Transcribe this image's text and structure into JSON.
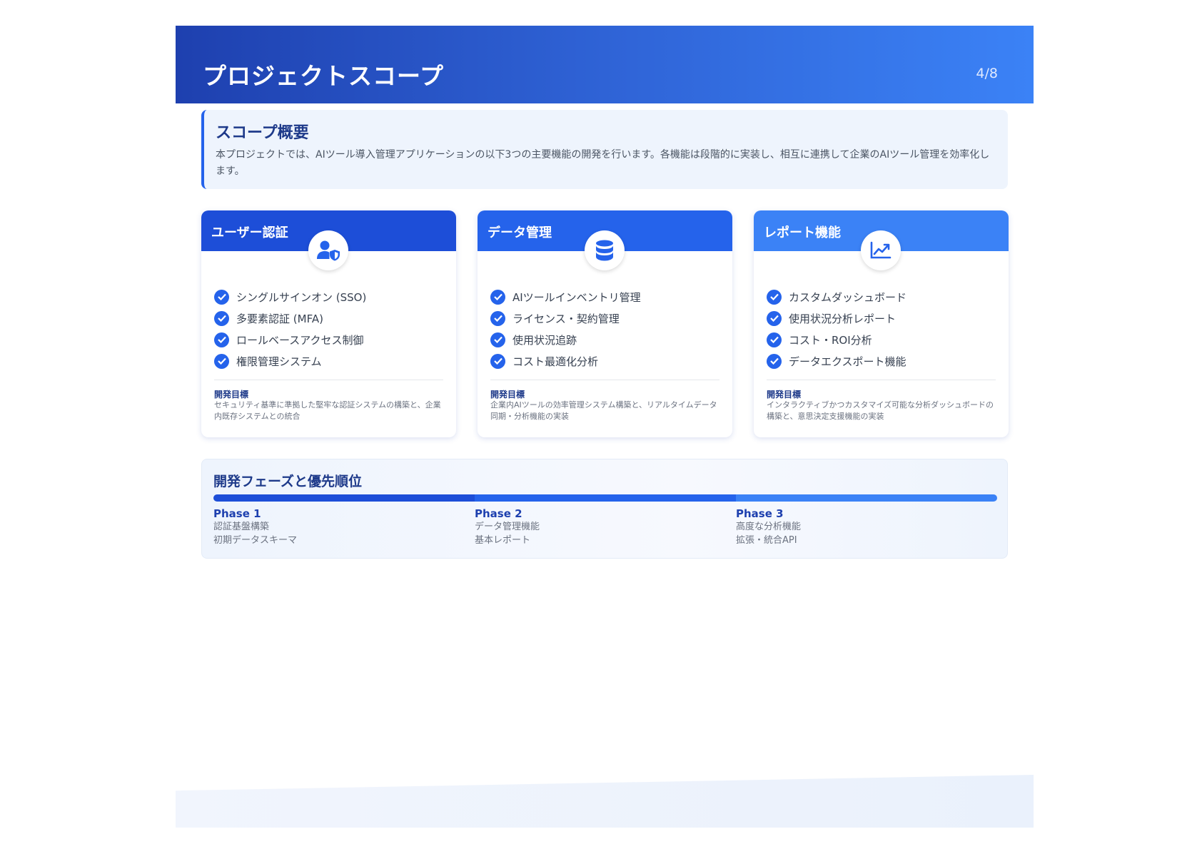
{
  "header": {
    "title": "プロジェクトスコープ",
    "page": "4/8"
  },
  "overview": {
    "title": "スコープ概要",
    "text": "本プロジェクトでは、AIツール導入管理アプリケーションの以下3つの主要機能の開発を行います。各機能は段階的に実装し、相互に連携して企業のAIツール管理を効率化します。"
  },
  "cards": [
    {
      "title": "ユーザー認証",
      "icon": "user-shield-icon",
      "header_color": "#1d4ed8",
      "items": [
        "シングルサインオン (SSO)",
        "多要素認証 (MFA)",
        "ロールベースアクセス制御",
        "権限管理システム"
      ],
      "goal_label": "開発目標",
      "goal_text": "セキュリティ基準に準拠した堅牢な認証システムの構築と、企業内既存システムとの統合"
    },
    {
      "title": "データ管理",
      "icon": "database-icon",
      "header_color": "#2563eb",
      "items": [
        "AIツールインベントリ管理",
        "ライセンス・契約管理",
        "使用状況追跡",
        "コスト最適化分析"
      ],
      "goal_label": "開発目標",
      "goal_text": "企業内AIツールの効率管理システム構築と、リアルタイムデータ同期・分析機能の実装"
    },
    {
      "title": "レポート機能",
      "icon": "chart-line-icon",
      "header_color": "#3b82f6",
      "items": [
        "カスタムダッシュボード",
        "使用状況分析レポート",
        "コスト・ROI分析",
        "データエクスポート機能"
      ],
      "goal_label": "開発目標",
      "goal_text": "インタラクティブかつカスタマイズ可能な分析ダッシュボードの構築と、意思決定支援機能の実装"
    }
  ],
  "phases": {
    "title": "開発フェーズと優先順位",
    "colors": [
      "#1d4ed8",
      "#2563eb",
      "#3b82f6"
    ],
    "items": [
      {
        "name": "Phase 1",
        "lines": [
          "認証基盤構築",
          "初期データスキーマ"
        ]
      },
      {
        "name": "Phase 2",
        "lines": [
          "データ管理機能",
          "基本レポート"
        ]
      },
      {
        "name": "Phase 3",
        "lines": [
          "高度な分析機能",
          "拡張・統合API"
        ]
      }
    ]
  }
}
